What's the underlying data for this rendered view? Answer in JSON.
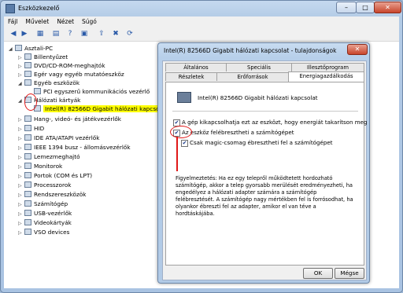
{
  "window": {
    "title": "Eszközkezelő",
    "minimize": "–",
    "maximize": "□",
    "close": "✕"
  },
  "menu": [
    "Fájl",
    "Művelet",
    "Nézet",
    "Súgó"
  ],
  "toolbar": {
    "icons": [
      "back-icon",
      "forward-icon",
      "view-icon",
      "properties-icon",
      "help-icon",
      "console-icon",
      "update-driver-icon",
      "uninstall-icon",
      "scan-icon"
    ],
    "glyphs": [
      "◀",
      "▶",
      "▦",
      "▤",
      "?",
      "▣",
      "⇪",
      "✖",
      "⟳"
    ]
  },
  "tree": [
    {
      "label": "Asztali-PC",
      "expander": "◢",
      "level": 0,
      "icon": "computer-icon"
    },
    {
      "label": "Billentyűzet",
      "expander": "▷",
      "level": 1,
      "icon": "keyboard-icon"
    },
    {
      "label": "DVD/CD-ROM-meghajtók",
      "expander": "▷",
      "level": 1,
      "icon": "dvd-icon"
    },
    {
      "label": "Egér vagy egyéb mutatóeszköz",
      "expander": "▷",
      "level": 1,
      "icon": "mouse-icon"
    },
    {
      "label": "Egyéb eszközök",
      "expander": "◢",
      "level": 1,
      "icon": "warning-device-icon"
    },
    {
      "label": "PCI egyszerű kommunikációs vezérlő",
      "expander": "",
      "level": 2,
      "icon": "unknown-device-icon"
    },
    {
      "label": "Hálózati kártyák",
      "expander": "◢",
      "level": 1,
      "icon": "network-icon"
    },
    {
      "label": "Intel(R) 82566D Gigabit hálózati kapcsolat",
      "expander": "",
      "level": 2,
      "icon": "network-adapter-icon",
      "highlight": true
    },
    {
      "label": "Hang-, videó- és játékvezérlők",
      "expander": "▷",
      "level": 1,
      "icon": "sound-icon"
    },
    {
      "label": "HID",
      "expander": "▷",
      "level": 1,
      "icon": "hid-icon"
    },
    {
      "label": "IDE ATA/ATAPI vezérlők",
      "expander": "▷",
      "level": 1,
      "icon": "ide-icon"
    },
    {
      "label": "IEEE 1394 busz - állomásvezérlők",
      "expander": "▷",
      "level": 1,
      "icon": "firewire-icon"
    },
    {
      "label": "Lemezmeghajtó",
      "expander": "▷",
      "level": 1,
      "icon": "disk-icon"
    },
    {
      "label": "Monitorok",
      "expander": "▷",
      "level": 1,
      "icon": "monitor-icon"
    },
    {
      "label": "Portok (COM és LPT)",
      "expander": "▷",
      "level": 1,
      "icon": "port-icon"
    },
    {
      "label": "Processzorok",
      "expander": "▷",
      "level": 1,
      "icon": "cpu-icon"
    },
    {
      "label": "Rendszereszközök",
      "expander": "▷",
      "level": 1,
      "icon": "system-icon"
    },
    {
      "label": "Számítógép",
      "expander": "▷",
      "level": 1,
      "icon": "computer-icon"
    },
    {
      "label": "USB-vezérlők",
      "expander": "▷",
      "level": 1,
      "icon": "usb-icon"
    },
    {
      "label": "Videokártyák",
      "expander": "▷",
      "level": 1,
      "icon": "display-icon"
    },
    {
      "label": "VSO devices",
      "expander": "▷",
      "level": 1,
      "icon": "vso-icon"
    }
  ],
  "dialog": {
    "title": "Intel(R) 82566D Gigabit hálózati kapcsolat - tulajdonságok",
    "close": "✕",
    "tabs_row1": [
      "Általános",
      "Speciális",
      "Illesztőprogram"
    ],
    "tabs_row2": [
      "Részletek",
      "Erőforrások",
      "Energiagazdálkodás"
    ],
    "device_name": "Intel(R) 82566D Gigabit hálózati kapcsolat",
    "options": [
      {
        "label": "A gép kikapcsolhatja ezt az eszközt, hogy energiát takarítson meg",
        "checked": "✔"
      },
      {
        "label": "Az eszköz felébresztheti a számítógépet",
        "checked": "✔"
      },
      {
        "label": "Csak magic-csomag ébresztheti fel a számítógépet",
        "checked": "✔"
      }
    ],
    "warning": "Figyelmeztetés: Ha ez egy telepről működtetett hordozható számítógép, akkor a telep gyorsabb merülését eredményezheti, ha engedélyez a hálózati adapter számára a számítógép felébresztését. A számítógép nagy mértékben fel is forrósodhat, ha olyankor ébreszti fel az adapter, amikor el van téve a hordtáskájába.",
    "ok": "OK",
    "cancel": "Mégse"
  }
}
